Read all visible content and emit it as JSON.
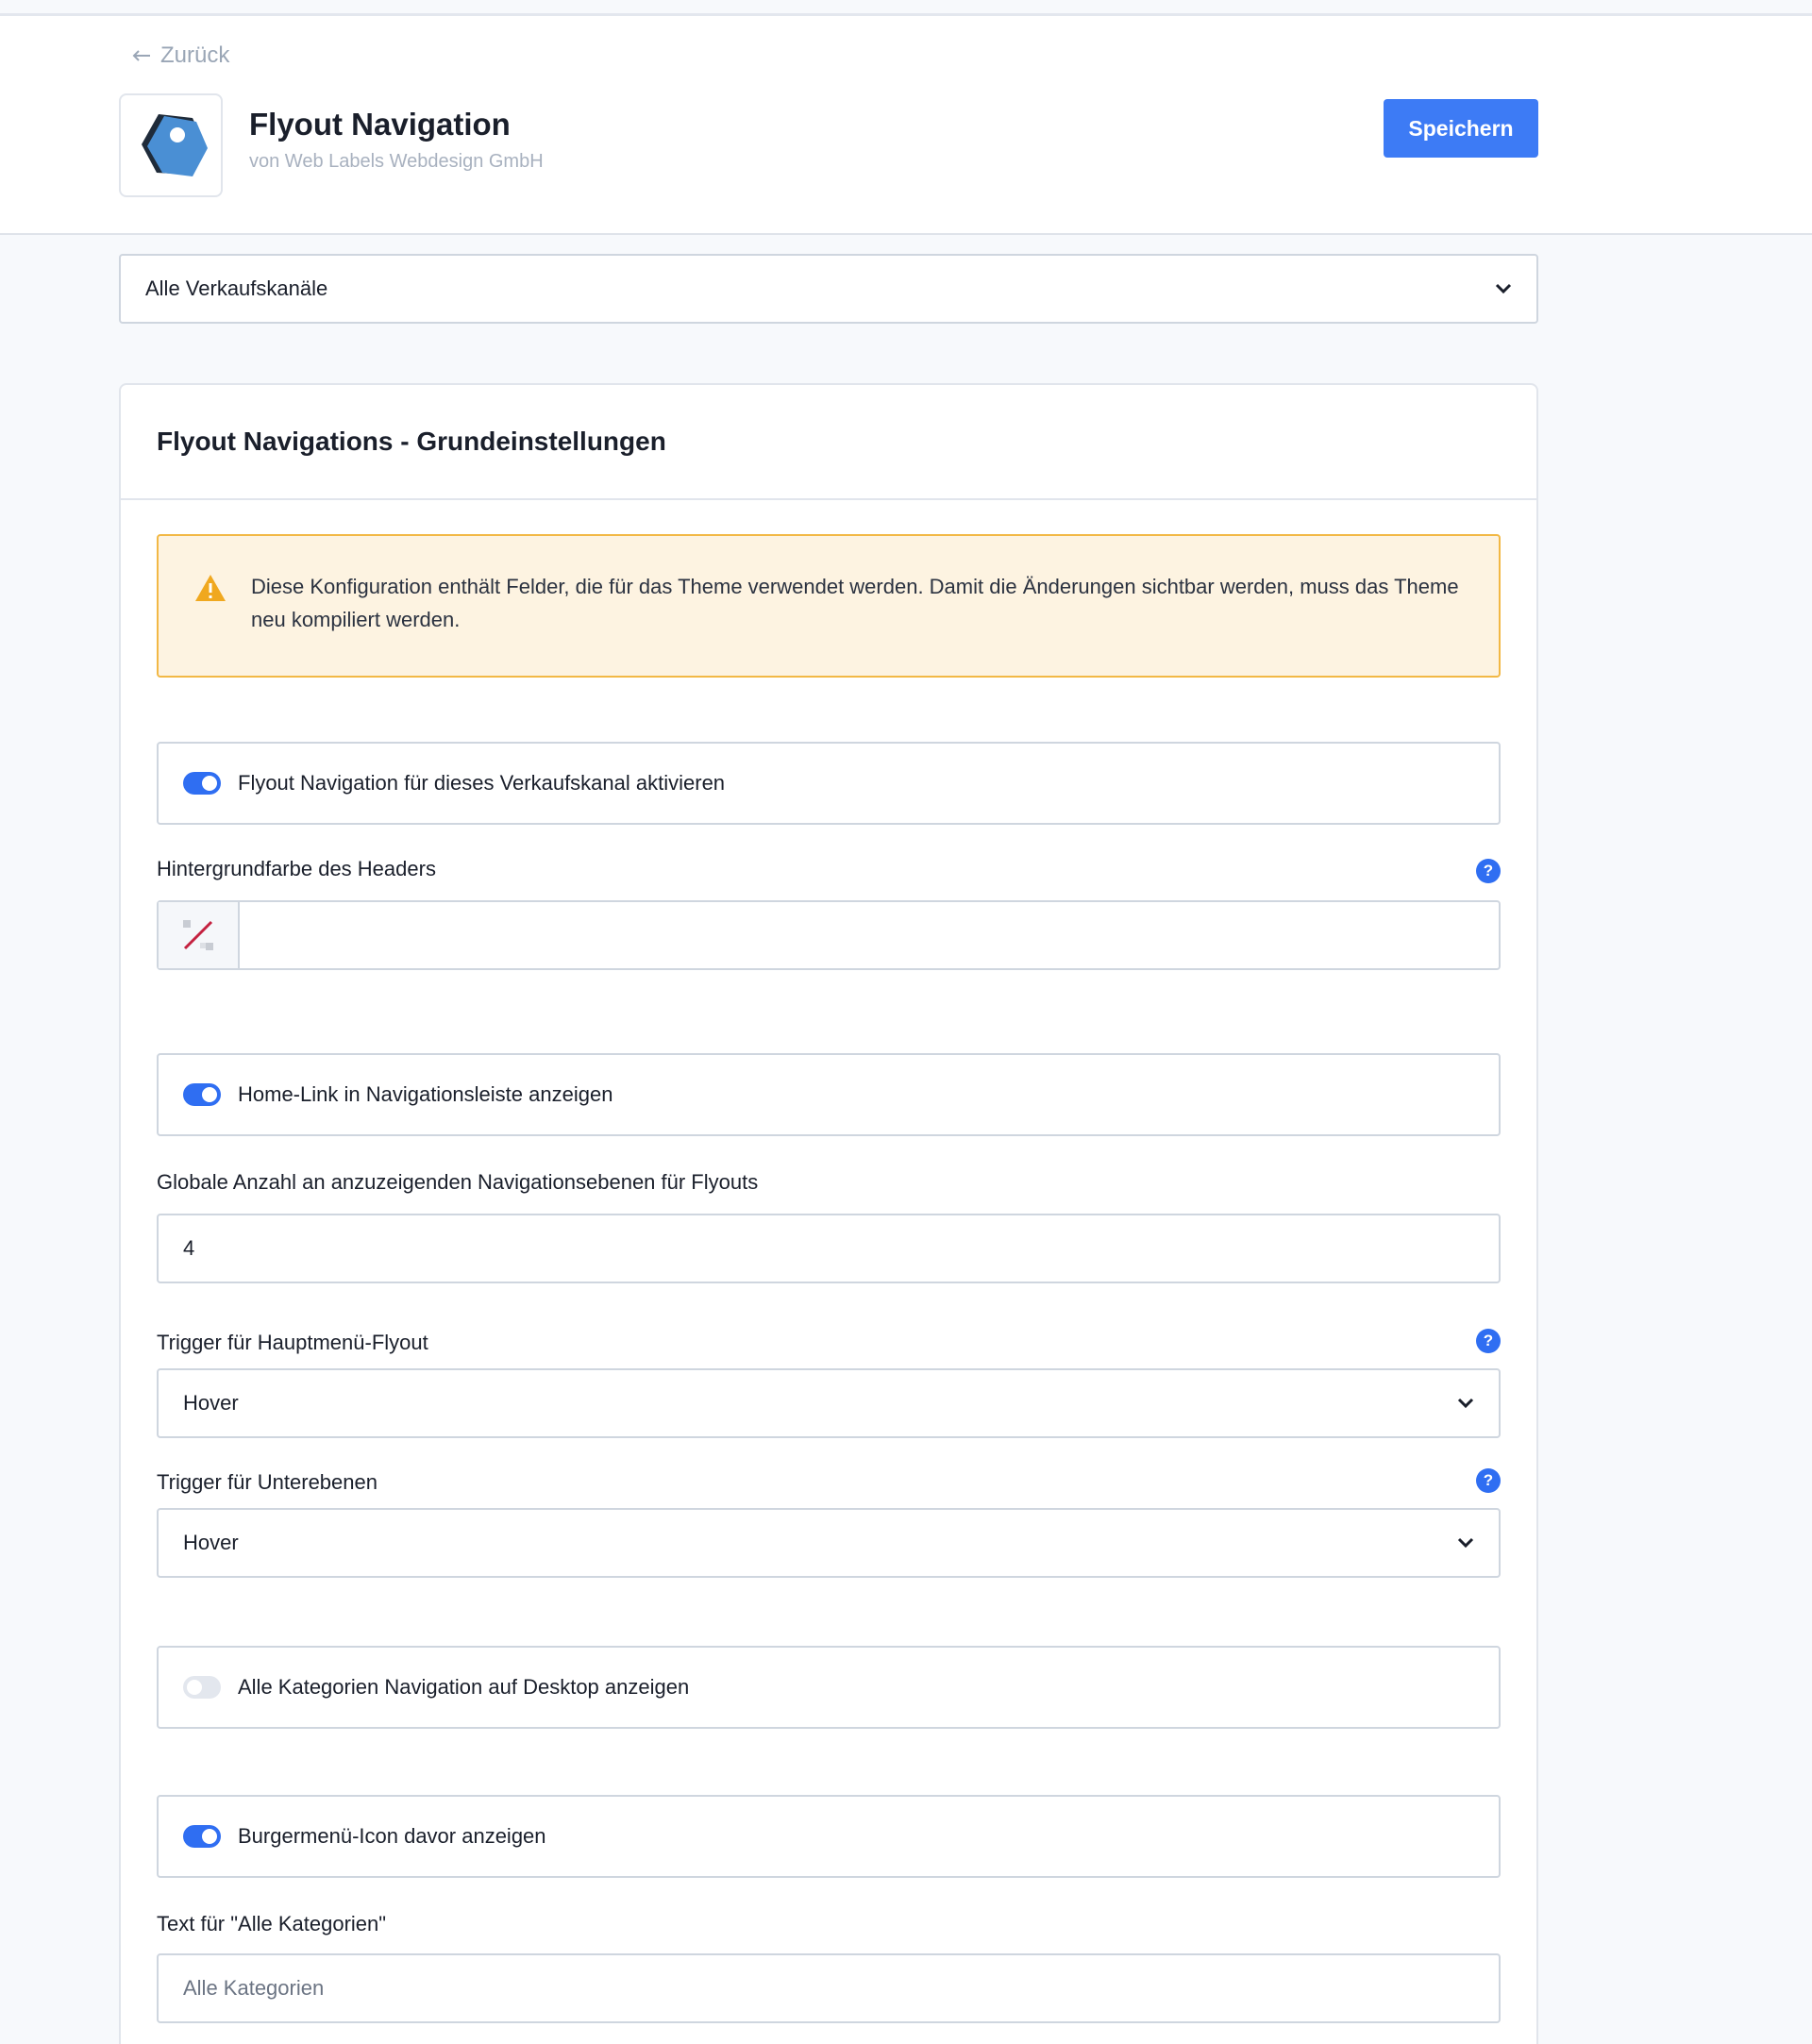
{
  "header": {
    "back_label": "Zurück",
    "app_title": "Flyout Navigation",
    "app_vendor": "von Web Labels Webdesign GmbH",
    "save_label": "Speichern"
  },
  "channel_select": {
    "value": "Alle Verkaufskanäle"
  },
  "card": {
    "title": "Flyout Navigations - Grundeinstellungen",
    "warning": "Diese Konfiguration enthält Felder, die für das Theme verwendet werden. Damit die Änderungen sichtbar werden, muss das Theme neu kompiliert werden.",
    "toggles": [
      {
        "label": "Flyout Navigation für dieses Verkaufskanal aktivieren",
        "on": true
      },
      {
        "label": "Home-Link in Navigationsleiste anzeigen",
        "on": true
      },
      {
        "label": "Alle Kategorien Navigation auf Desktop anzeigen",
        "on": false
      },
      {
        "label": "Burgermenü-Icon davor anzeigen",
        "on": true
      }
    ],
    "fields": {
      "header_bg": {
        "label": "Hintergrundfarbe des Headers",
        "value": ""
      },
      "levels": {
        "label": "Globale Anzahl an anzuzeigenden Navigationsebenen für Flyouts",
        "value": "4"
      },
      "main_trigger": {
        "label": "Trigger für Hauptmenü-Flyout",
        "value": "Hover"
      },
      "sub_trigger": {
        "label": "Trigger für Unterebenen",
        "value": "Hover"
      },
      "all_categories_text": {
        "label": "Text für \"Alle Kategorien\"",
        "placeholder": "Alle Kategorien"
      }
    }
  },
  "colors": {
    "primary": "#3d7bf5",
    "toggle_on": "#2f6ef2",
    "warning_bg": "#fdf3e1",
    "warning_border": "#f2b845"
  }
}
